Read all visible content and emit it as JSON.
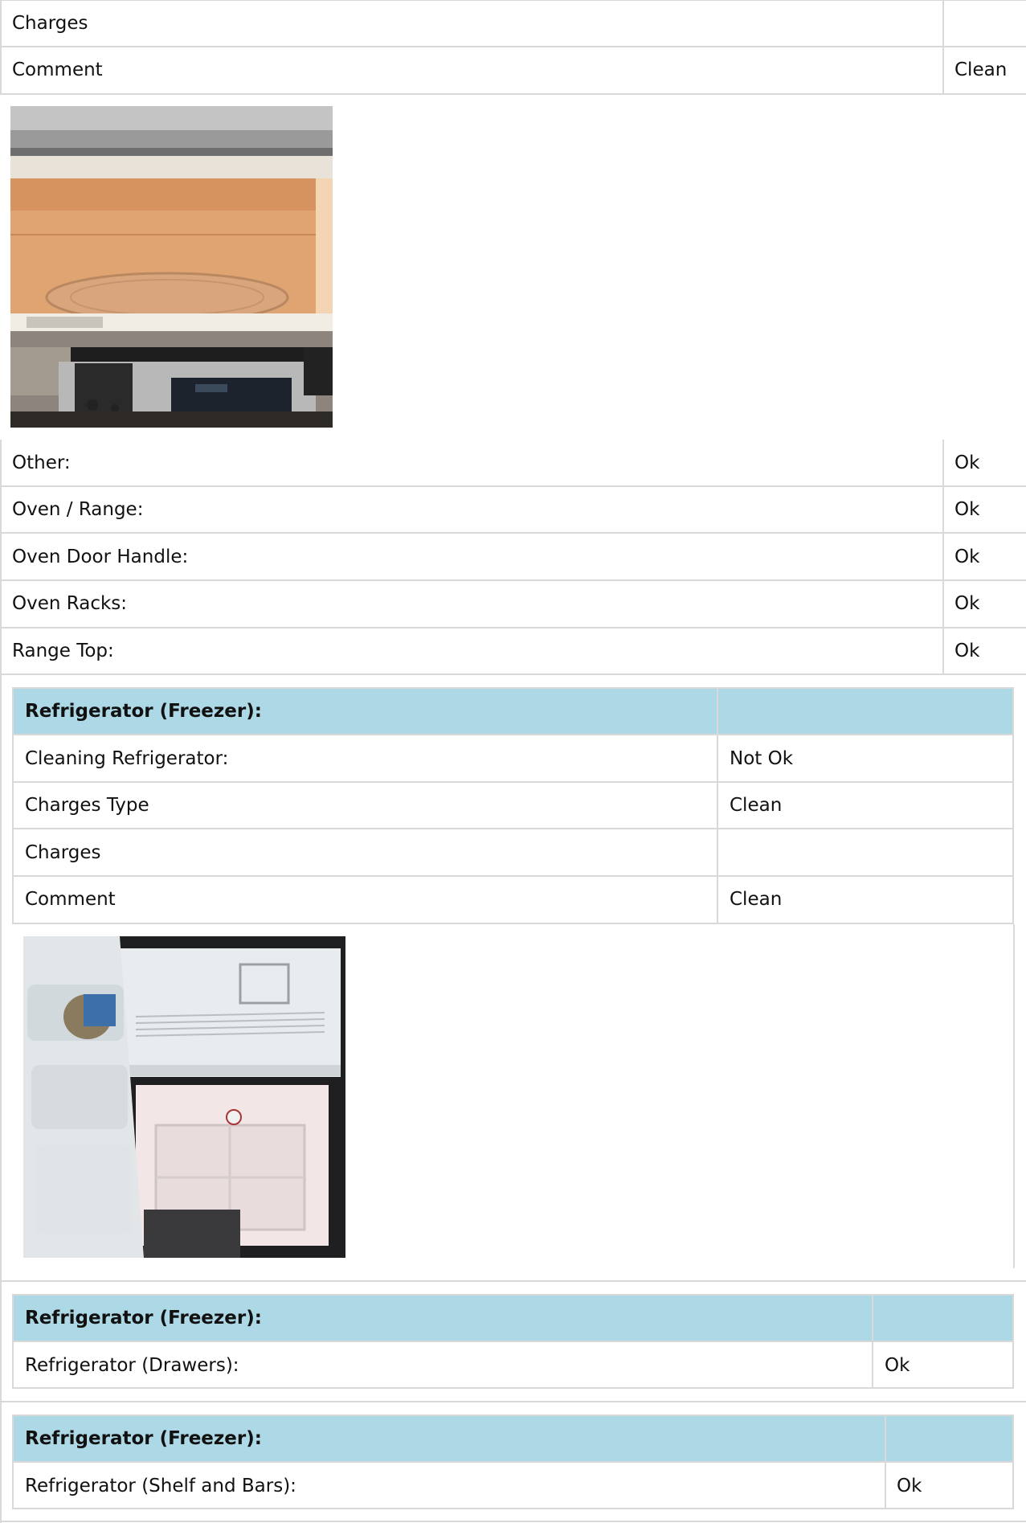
{
  "top_table": {
    "rows": [
      {
        "label": "Charges",
        "value": ""
      },
      {
        "label": "Comment",
        "value": "Clean"
      }
    ]
  },
  "microwave_photo": {
    "subject": "microwave-interior-photo"
  },
  "appliance_table": {
    "rows": [
      {
        "label": "Other:",
        "value": "Ok"
      },
      {
        "label": "Oven / Range:",
        "value": "Ok"
      },
      {
        "label": "Oven Door Handle:",
        "value": "Ok"
      },
      {
        "label": "Oven Racks:",
        "value": "Ok"
      },
      {
        "label": "Range Top:",
        "value": "Ok"
      }
    ]
  },
  "freezer_section": {
    "title": "Refrigerator (Freezer):",
    "rows": [
      {
        "label": "Cleaning Refrigerator:",
        "value": "Not Ok"
      },
      {
        "label": "Charges Type",
        "value": "Clean"
      },
      {
        "label": "Charges",
        "value": ""
      },
      {
        "label": "Comment",
        "value": "Clean"
      }
    ],
    "photo": {
      "subject": "refrigerator-open-photo"
    }
  },
  "drawers_section": {
    "title": "Refrigerator (Freezer):",
    "rows": [
      {
        "label": "Refrigerator (Drawers):",
        "value": "Ok"
      }
    ]
  },
  "shelf_section": {
    "title": "Refrigerator (Freezer):",
    "rows": [
      {
        "label": "Refrigerator (Shelf and Bars):",
        "value": "Ok"
      }
    ]
  },
  "colors": {
    "header_bg": "#add8e6",
    "border": "#d9d9d9",
    "text": "#111111"
  }
}
